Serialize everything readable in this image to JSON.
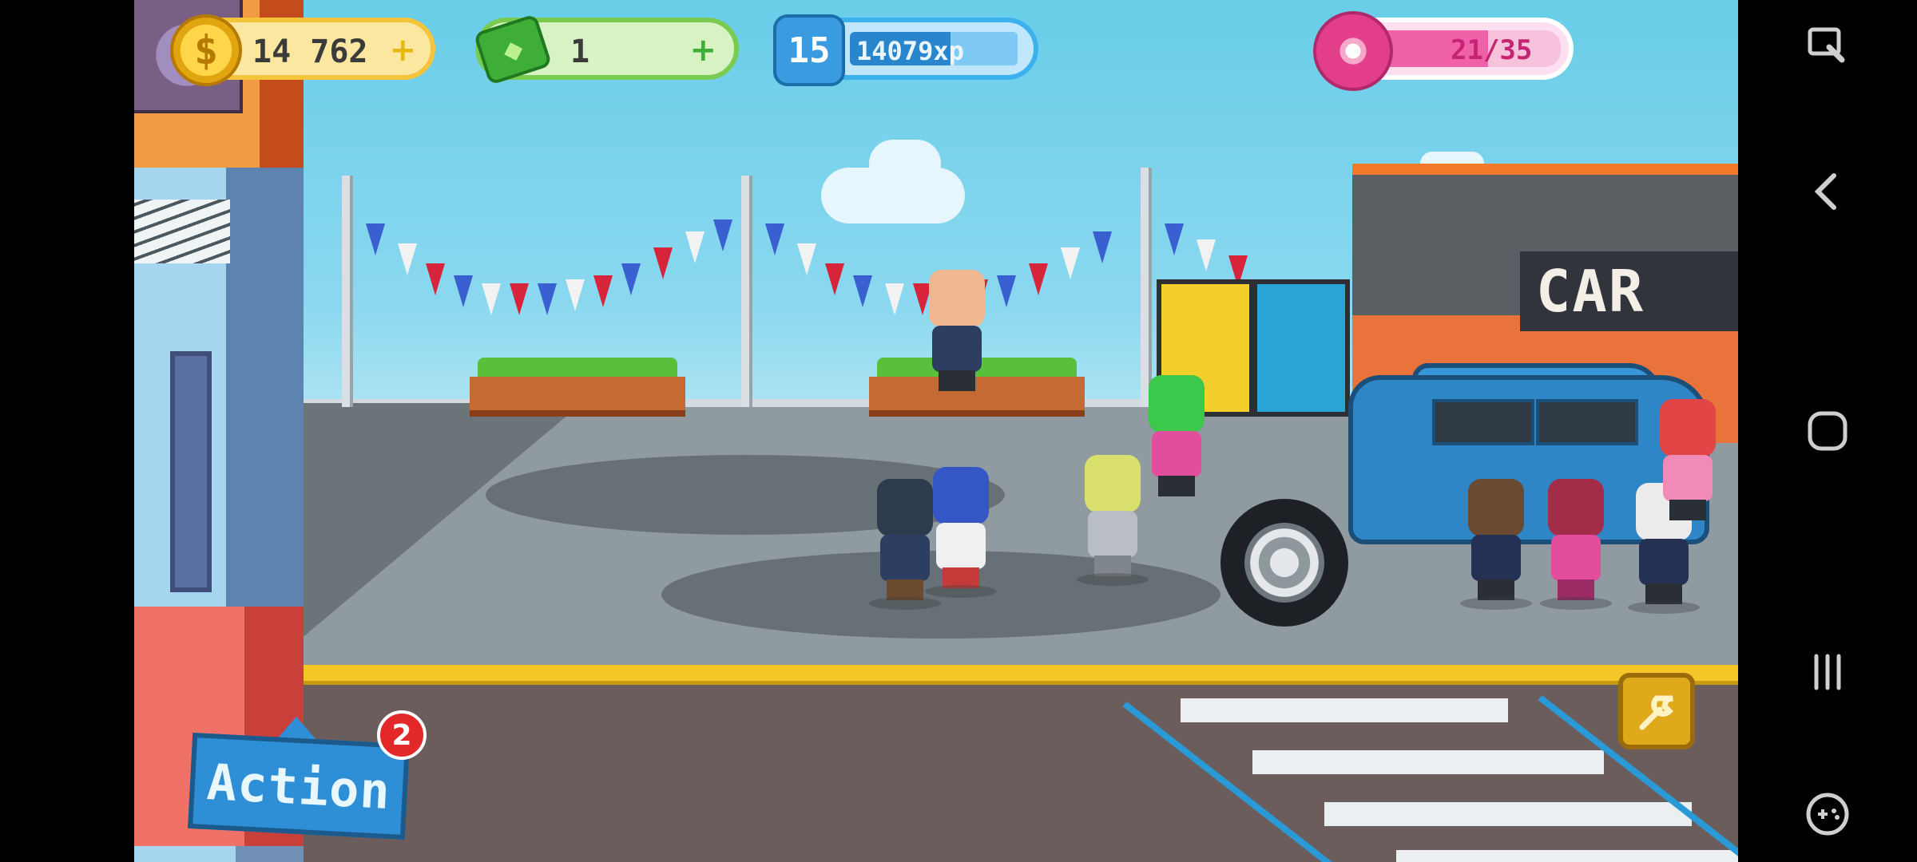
{
  "hud": {
    "coins": "14 762",
    "coins_plus": "+",
    "cash": "1",
    "cash_plus": "+",
    "level": "15",
    "xp": "14079xp",
    "xp_progress": 0.6,
    "donuts": "21/35",
    "donut_progress": 0.6
  },
  "scene": {
    "shop_sign": "CAR"
  },
  "action_button": {
    "label": "Action",
    "badge": "2"
  },
  "colors": {
    "coin": "#f4c53a",
    "cash": "#79cc4f",
    "xp": "#3db1ec",
    "donut": "#e23e8b",
    "action": "#2e8fd6",
    "badge": "#e22828"
  },
  "icons": {
    "coin": "dollar-coin-icon",
    "cash": "cash-bill-icon",
    "xp": "level-star-icon",
    "donut": "donut-icon",
    "wrench": "wrench-icon",
    "nav": [
      "screenshot-pen-icon",
      "back-icon",
      "home-icon",
      "recents-icon",
      "gamepad-icon"
    ]
  }
}
